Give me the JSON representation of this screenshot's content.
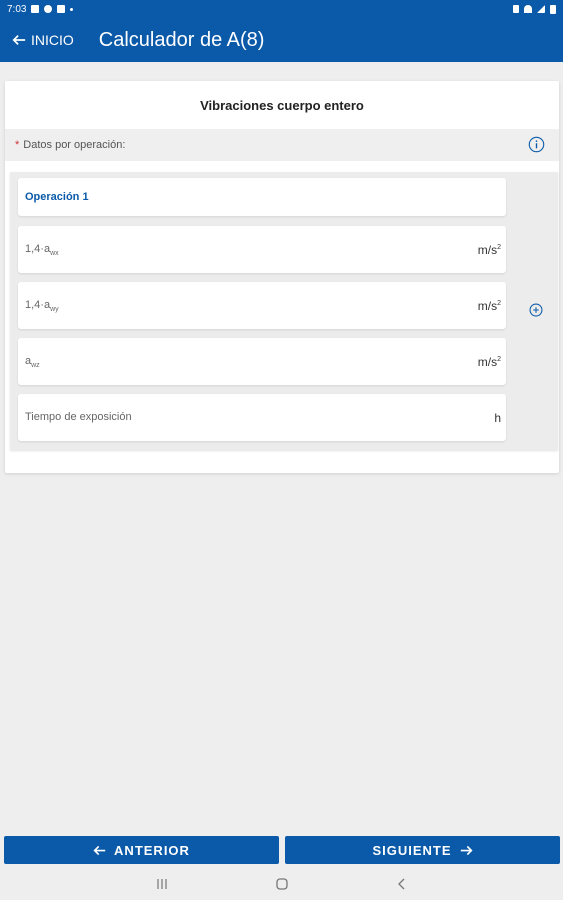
{
  "statusbar": {
    "time": "7:03"
  },
  "appbar": {
    "back_label": "INICIO",
    "title": "Calculador de A(8)"
  },
  "card": {
    "title": "Vibraciones cuerpo entero",
    "required_mark": "*",
    "datos_label": "Datos por operación:"
  },
  "operation": {
    "title": "Operación 1",
    "fields": [
      {
        "label": "1,4·a",
        "sub": "wx",
        "unit": "m/s",
        "unit_sup": "2"
      },
      {
        "label": "1,4·a",
        "sub": "wy",
        "unit": "m/s",
        "unit_sup": "2"
      },
      {
        "label": "a",
        "sub": "wz",
        "unit": "m/s",
        "unit_sup": "2"
      },
      {
        "label": "Tiempo de exposición",
        "sub": "",
        "unit": "h",
        "unit_sup": ""
      }
    ]
  },
  "footer": {
    "prev_label": "ANTERIOR",
    "next_label": "SIGUIENTE"
  },
  "colors": {
    "primary": "#0b5aa9",
    "background": "#eeeeee",
    "required": "#d32f2f"
  },
  "icons": [
    "back-arrow-icon",
    "info-icon",
    "add-circle-icon",
    "forward-arrow-icon",
    "recent-apps-icon",
    "home-icon",
    "nav-back-icon"
  ]
}
